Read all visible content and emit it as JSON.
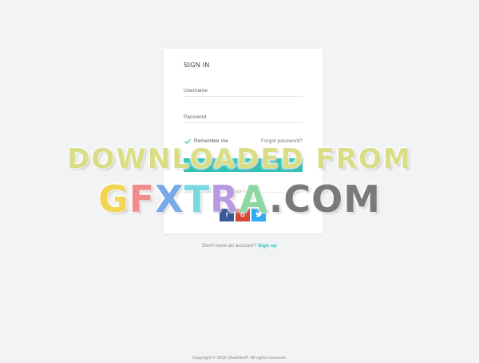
{
  "signin": {
    "title": "SIGN IN",
    "username_placeholder": "Username",
    "password_placeholder": "Password",
    "remember_label": "Remember me",
    "remember_checked": true,
    "forgot_label": "Forgot password?",
    "login_label": "LOGIN",
    "divider_label": "or sign in with",
    "social": [
      {
        "name": "facebook",
        "glyph": "f",
        "color": "#3b5998"
      },
      {
        "name": "google",
        "glyph": "G",
        "color": "#d34836"
      },
      {
        "name": "twitter",
        "glyph": "✔",
        "color": "#33aaf3"
      }
    ]
  },
  "signup": {
    "prompt": "Don't have an account?",
    "link": "Sign up"
  },
  "footer": {
    "copyright": "Copyright © 2016 ShaMSofT. All rights reserved."
  },
  "watermark": {
    "line1": "DOWNLOADED FROM",
    "line2_parts": [
      "G",
      "F",
      "X",
      "T",
      "R",
      "A",
      ".",
      "COM"
    ]
  },
  "colors": {
    "accent": "#2ec4b6",
    "background": "#f2f3f5"
  }
}
